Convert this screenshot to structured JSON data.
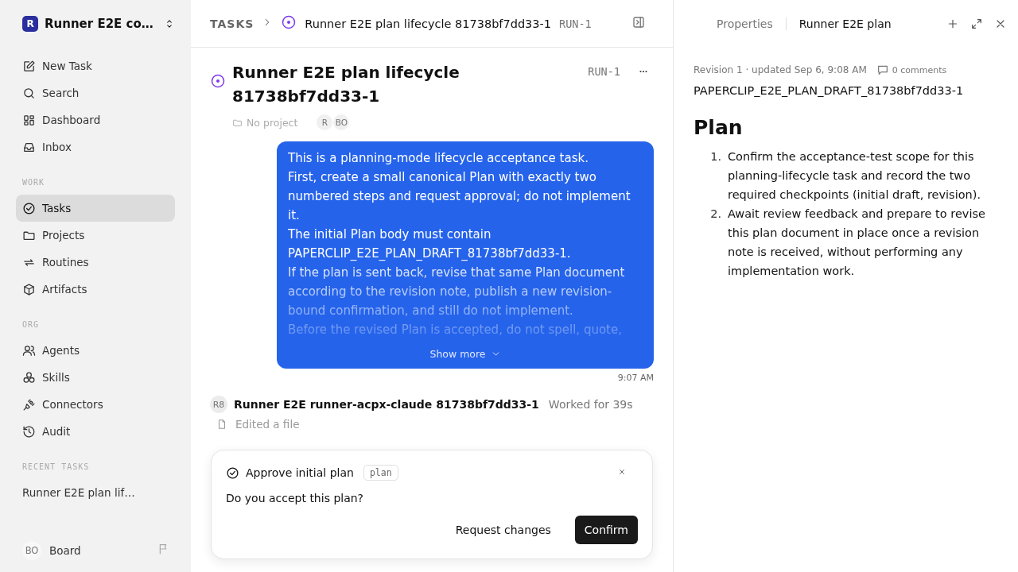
{
  "workspace": {
    "logo": "R",
    "name": "Runner E2E co…"
  },
  "sidebar": {
    "top_items": [
      {
        "label": "New Task",
        "selected": false
      },
      {
        "label": "Search",
        "selected": false
      },
      {
        "label": "Dashboard",
        "selected": false
      },
      {
        "label": "Inbox",
        "selected": false
      }
    ],
    "sections": [
      {
        "title": "WORK",
        "items": [
          {
            "label": "Tasks",
            "selected": true
          },
          {
            "label": "Projects",
            "selected": false
          },
          {
            "label": "Routines",
            "selected": false
          },
          {
            "label": "Artifacts",
            "selected": false
          }
        ]
      },
      {
        "title": "ORG",
        "items": [
          {
            "label": "Agents",
            "selected": false
          },
          {
            "label": "Skills",
            "selected": false
          },
          {
            "label": "Connectors",
            "selected": false
          },
          {
            "label": "Audit",
            "selected": false
          }
        ]
      }
    ],
    "recent_title": "RECENT TASKS",
    "recent_tasks": [
      "Runner E2E plan lif…"
    ],
    "user": {
      "initials": "BO",
      "name": "Board"
    }
  },
  "breadcrumb": {
    "root": "TASKS",
    "title": "Runner E2E plan lifecycle 81738bf7dd33-1",
    "id": "RUN-1"
  },
  "task": {
    "title": "Runner E2E plan lifecycle 81738bf7dd33-1",
    "id": "RUN-1",
    "project": "No project",
    "assignees": [
      "R",
      "BO"
    ]
  },
  "message": {
    "paragraphs": [
      "This is a planning-mode lifecycle acceptance task.",
      "First, create a small canonical Plan with exactly two numbered steps and request approval; do not implement it.",
      "The initial Plan body must contain PAPERCLIP_E2E_PLAN_DRAFT_81738bf7dd33-1.",
      "If the plan is sent back, revise that same Plan document according to the revision note, publish a new revision-bound confirmation, and still do not implement.",
      "Before the revised Plan is accepted, do not spell, quote,"
    ],
    "show_more": "Show more",
    "time": "9:07 AM"
  },
  "run": {
    "avatar": "R8",
    "agent": "Runner E2E runner-acpx-claude 81738bf7dd33-1",
    "duration": "Worked for 39s",
    "activity": "Edited a file"
  },
  "interaction": {
    "title": "Approve initial plan",
    "tag": "plan",
    "question": "Do you accept this plan?",
    "secondary": "Request changes",
    "primary": "Confirm"
  },
  "panel": {
    "tabs": [
      {
        "label": "Properties",
        "selected": false
      },
      {
        "label": "Runner E2E plan",
        "selected": true
      }
    ],
    "meta": "Revision 1 · updated Sep 6, 9:08 AM",
    "comments": "0 comments",
    "key": "PAPERCLIP_E2E_PLAN_DRAFT_81738bf7dd33-1",
    "heading": "Plan",
    "steps": [
      {
        "number": "1.",
        "text": "Confirm the acceptance-test scope for this planning-lifecycle task and record the two required checkpoints (initial draft, revision)."
      },
      {
        "number": "2.",
        "text": "Await review feedback and prepare to revise this plan document in place once a revision note is received, without performing any implementation work."
      }
    ]
  }
}
